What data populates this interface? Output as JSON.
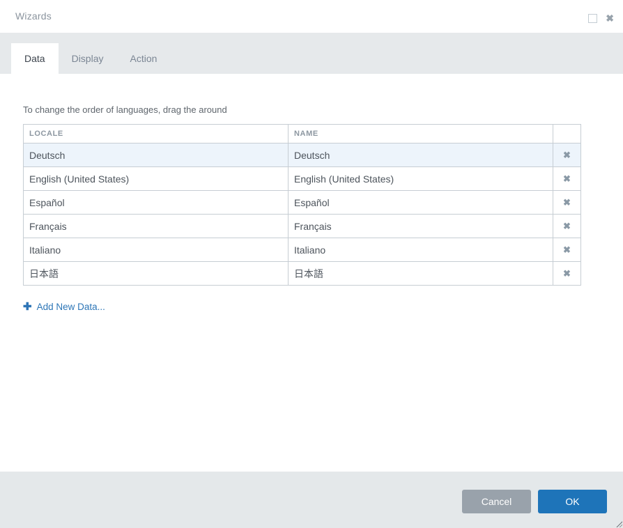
{
  "window": {
    "title": "Wizards",
    "maximize_icon_glyph": "",
    "close_icon_glyph": "✖"
  },
  "tabs": [
    {
      "label": "Data",
      "active": true
    },
    {
      "label": "Display",
      "active": false
    },
    {
      "label": "Action",
      "active": false
    }
  ],
  "instruction": "To change the order of languages, drag the around",
  "table": {
    "columns": [
      "LOCALE",
      "NAME",
      ""
    ],
    "delete_icon_glyph": "✖",
    "rows": [
      {
        "locale": "Deutsch",
        "name": "Deutsch",
        "selected": true
      },
      {
        "locale": "English (United States)",
        "name": "English (United States)",
        "selected": false
      },
      {
        "locale": "Español",
        "name": "Español",
        "selected": false
      },
      {
        "locale": "Français",
        "name": "Français",
        "selected": false
      },
      {
        "locale": "Italiano",
        "name": "Italiano",
        "selected": false
      },
      {
        "locale": "日本語",
        "name": "日本語",
        "selected": false
      }
    ]
  },
  "add_link": {
    "icon_glyph": "✚",
    "label": "Add New Data..."
  },
  "footer": {
    "cancel_label": "Cancel",
    "ok_label": "OK"
  },
  "colors": {
    "accent_blue": "#1e74b9",
    "link_blue": "#2d76b7",
    "cancel_gray": "#99a2ab",
    "selected_row_bg": "#edf4fb",
    "tab_strip_bg": "#e6e9eb",
    "footer_bg": "#e4e8ea"
  }
}
